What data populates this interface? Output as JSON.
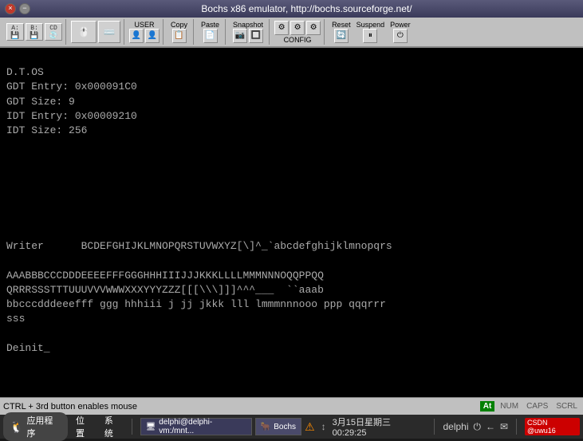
{
  "titlebar": {
    "title": "Bochs x86 emulator, http://bochs.sourceforge.net/",
    "close_label": "×",
    "min_label": "−"
  },
  "toolbar": {
    "user_label": "USER",
    "copy_label": "Copy",
    "paste_label": "Paste",
    "snapshot_label": "Snapshot",
    "config_label": "CONFIG",
    "reset_label": "Reset",
    "suspend_label": "Suspend",
    "power_label": "Power"
  },
  "terminal": {
    "lines": [
      "D.T.OS",
      "GDT Entry: 0x000091C0",
      "GDT Size: 9",
      "IDT Entry: 0x00009210",
      "IDT Size: 256",
      "",
      "",
      "",
      "",
      "",
      "",
      "",
      "Writer      BCDEFGHIJKLMNOPQRSTUVWXYZ[\\]^_`abcdefghijklmnopqrs",
      "",
      "AAABBBCCCDDDEEEEFFFGGGHHHIIIJJJKKKLLLLMMMNNNOQQPPQQ",
      "QRRRSSSTTTUUUVVVWWWXXXYYYZZZ[[[\\\\\\]]]^^^___  ``aaab",
      "bbcccdddeeefff ggg hhhiii j jj jkkk lll lmmmnnnooo ppp qqqrrr",
      "sss",
      "",
      "Deinit_",
      "",
      "",
      "",
      "",
      "",
      ""
    ]
  },
  "statusbar": {
    "text": "CTRL + 3rd button enables mouse",
    "badge": "At",
    "num": "NUM",
    "caps": "CAPS",
    "scrl": "SCRL"
  },
  "taskbar": {
    "start_label": "应用程序",
    "menu_items": [
      "位置",
      "系统"
    ],
    "warning_text": "⚠",
    "arrows_text": "↓↑",
    "datetime": "3月15日星期三 00:29:25",
    "tray_items": [
      "delphi",
      "⏻",
      "←",
      "✉"
    ],
    "app1_label": "delphi@delphi-vm:/mnt...",
    "app1_icon": "🖥",
    "app2_label": "Bochs",
    "app2_icon": "🐂",
    "csdn_label": "CSDN @uwu16"
  }
}
